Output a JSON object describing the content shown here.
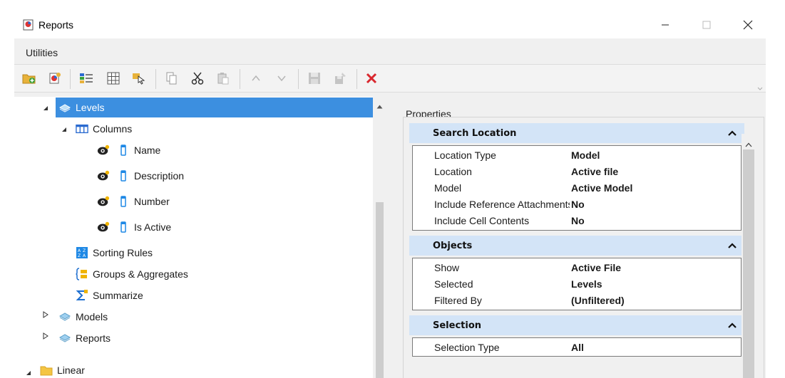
{
  "window": {
    "title": "Reports",
    "icon": "reports-app-icon"
  },
  "menu": {
    "items": [
      "Utilities"
    ]
  },
  "toolbar": {
    "buttons": [
      "new-folder-icon",
      "new-report-icon",
      "format-columns-icon",
      "table-icon",
      "select-icon",
      "copy-icon",
      "cut-icon",
      "paste-icon",
      "move-up-icon",
      "move-down-icon",
      "save-icon",
      "save-as-icon",
      "delete-icon"
    ]
  },
  "tree": {
    "levels": "Levels",
    "columns": "Columns",
    "col_items": [
      "Name",
      "Description",
      "Number",
      "Is Active"
    ],
    "sorting": "Sorting Rules",
    "groups": "Groups & Aggregates",
    "summarize": "Summarize",
    "models": "Models",
    "reports": "Reports",
    "linear": "Linear"
  },
  "properties": {
    "label": "Properties",
    "sections": [
      {
        "title": "Search Location",
        "rows": [
          {
            "name": "Location Type",
            "value": "Model"
          },
          {
            "name": "Location",
            "value": "Active file"
          },
          {
            "name": "Model",
            "value": "Active Model"
          },
          {
            "name": "Include Reference Attachments",
            "value": "No"
          },
          {
            "name": "Include Cell Contents",
            "value": "No"
          }
        ]
      },
      {
        "title": "Objects",
        "rows": [
          {
            "name": "Show",
            "value": "Active File"
          },
          {
            "name": "Selected",
            "value": "Levels"
          },
          {
            "name": "Filtered By",
            "value": "(Unfiltered)"
          }
        ]
      },
      {
        "title": "Selection",
        "rows": [
          {
            "name": "Selection Type",
            "value": "All"
          }
        ]
      }
    ]
  },
  "colors": {
    "selection": "#3c8fe0",
    "section_header": "#d3e4f7",
    "delete": "#d9272e"
  }
}
